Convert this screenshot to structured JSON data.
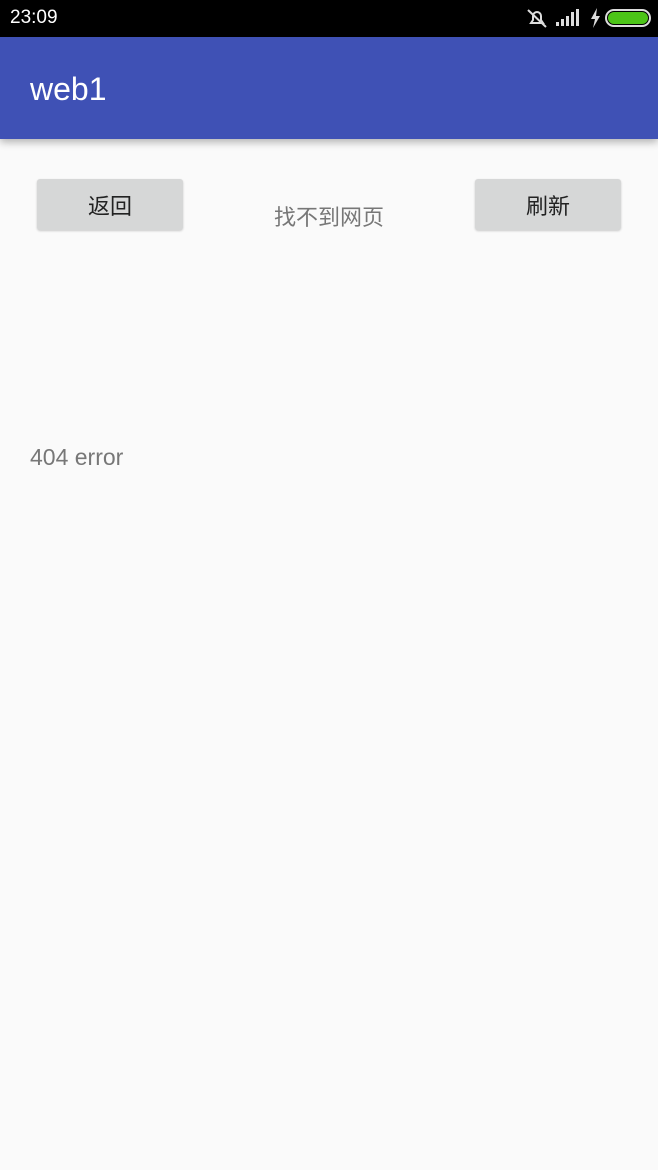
{
  "status_bar": {
    "time": "23:09",
    "icons": [
      "notifications-off-icon",
      "signal-icon",
      "charging-icon",
      "battery-icon"
    ],
    "battery_color": "#4cc417"
  },
  "app_bar": {
    "title": "web1",
    "color": "#3f51b5"
  },
  "toolbar": {
    "back_label": "返回",
    "page_title": "找不到网页",
    "refresh_label": "刷新"
  },
  "content": {
    "error_text": "404 error"
  }
}
